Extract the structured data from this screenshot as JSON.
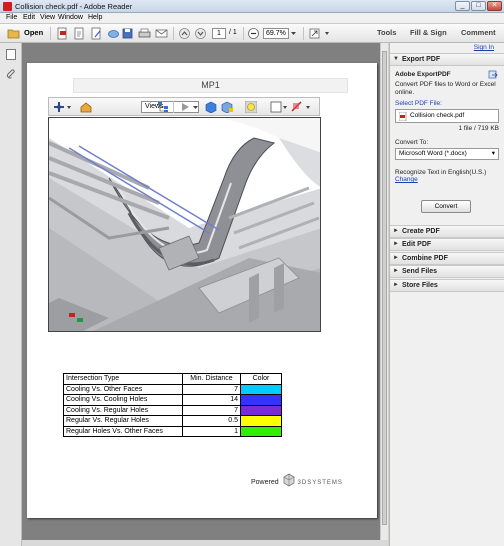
{
  "window": {
    "title": "Collision check.pdf - Adobe Reader",
    "controls": [
      "_",
      "□",
      "✕"
    ]
  },
  "menu": [
    "File",
    "Edit",
    "View",
    "Window",
    "Help"
  ],
  "toolbar": {
    "open_label": "Open",
    "page_current": "1",
    "page_total": "/ 1",
    "zoom": "69.7%",
    "tools_label": "Tools",
    "fill_sign_label": "Fill & Sign",
    "comment_label": "Comment"
  },
  "document": {
    "heading": "MP1",
    "views_label": "Views",
    "table": {
      "headers": [
        "Intersection Type",
        "Min. Distance",
        "Color"
      ],
      "rows": [
        {
          "type": "Cooling Vs. Other Faces",
          "distance": "7",
          "color": "#00ccff"
        },
        {
          "type": "Cooling Vs. Cooling Holes",
          "distance": "14",
          "color": "#3333ff"
        },
        {
          "type": "Cooling Vs. Regular Holes",
          "distance": "7",
          "color": "#7b2bd6"
        },
        {
          "type": "Regular Vs. Regular Holes",
          "distance": "0.5",
          "color": "#ffff00"
        },
        {
          "type": "Regular Holes Vs. Other Faces",
          "distance": "1",
          "color": "#33ee00"
        }
      ]
    },
    "powered_label": "Powered",
    "brand_label": "3DSYSTEMS"
  },
  "panel": {
    "sign_in": "Sign In",
    "export_title": "Export PDF",
    "exportpdf_title": "Adobe ExportPDF",
    "exportpdf_desc": "Convert PDF files to Word or Excel online.",
    "select_label": "Select PDF File:",
    "file_name": "Collision check.pdf",
    "file_info": "1 file / 719 KB",
    "convert_to_label": "Convert To:",
    "convert_to_value": "Microsoft Word (*.docx)",
    "recognize_text": "Recognize Text in English(U.S.)",
    "change_link": "Change",
    "convert_button": "Convert",
    "sections": [
      "Create PDF",
      "Edit PDF",
      "Combine PDF",
      "Send Files",
      "Store Files"
    ]
  }
}
